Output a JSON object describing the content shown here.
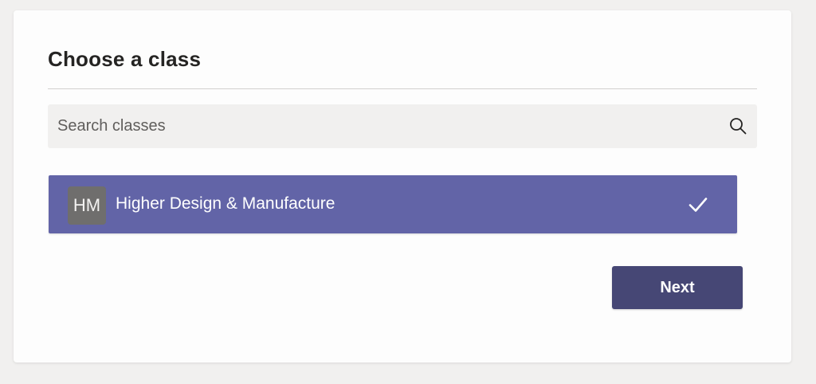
{
  "dialog": {
    "title": "Choose a class"
  },
  "search": {
    "placeholder": "Search classes",
    "value": "",
    "icon": "search-icon"
  },
  "classes": [
    {
      "initials": "HM",
      "name": "Higher Design & Manufacture",
      "selected": true,
      "selected_icon": "checkmark-icon"
    }
  ],
  "actions": {
    "next_label": "Next"
  },
  "colors": {
    "background": "#f1f0ef",
    "card": "#fdfdfd",
    "selected_item": "#6264a7",
    "avatar": "#6f6e6d",
    "next_button": "#464775"
  }
}
